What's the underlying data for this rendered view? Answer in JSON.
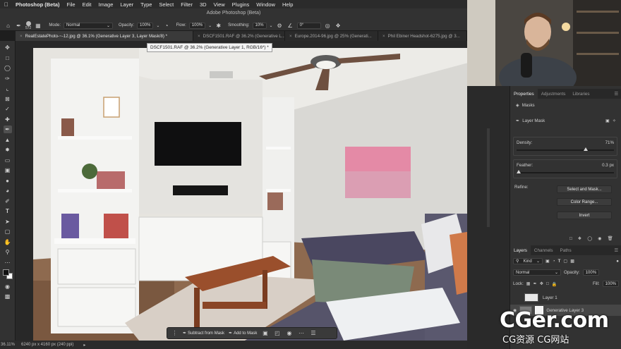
{
  "menubar": {
    "app_name": "Photoshop (Beta)",
    "items": [
      "File",
      "Edit",
      "Image",
      "Layer",
      "Type",
      "Select",
      "Filter",
      "3D",
      "View",
      "Plugins",
      "Window",
      "Help"
    ]
  },
  "window_title": "Adobe Photoshop (Beta)",
  "options": {
    "brush_size": "572",
    "mode_label": "Mode:",
    "mode_value": "Normal",
    "opacity_label": "Opacity:",
    "opacity_value": "100%",
    "flow_label": "Flow:",
    "flow_value": "100%",
    "smoothing_label": "Smoothing:",
    "smoothing_value": "10%",
    "angle_value": "0°"
  },
  "tabs": [
    {
      "label": "RealEstatePhoto-~-12.jpg @ 36.1% (Generative Layer 3, Layer Mask/8) *",
      "active": true
    },
    {
      "label": "DSCF1501.RAF @ 36.2% (Generative L...",
      "active": false
    },
    {
      "label": "Europe.2014-96.jpg @ 25% (Generati...",
      "active": false
    },
    {
      "label": "Phil Ebiner Headshot-6275.jpg @ 3...",
      "active": false
    }
  ],
  "tooltip": "DSCF1501.RAF @ 36.2% (Generative Layer 1, RGB/16*) *",
  "taskbar": {
    "subtract_label": "Subtract from Mask",
    "add_label": "Add to Mask"
  },
  "status": {
    "zoom": "36.11%",
    "doc_size": "6240 px x 4160 px (240 ppi)"
  },
  "properties": {
    "tabs": [
      "Properties",
      "Adjustments",
      "Libraries"
    ],
    "masks_label": "Masks",
    "layer_mask_label": "Layer Mask",
    "density_label": "Density:",
    "density_value": "71%",
    "density_level": 0.71,
    "feather_label": "Feather:",
    "feather_value": "0.3 px",
    "feather_level": 0.02,
    "refine_label": "Refine:",
    "select_mask_button": "Select and Mask...",
    "color_range_button": "Color Range...",
    "invert_button": "Invert"
  },
  "layers": {
    "tabs": [
      "Layers",
      "Channels",
      "Paths"
    ],
    "kind_label": "Kind",
    "blend_mode": "Normal",
    "opacity_label": "Opacity:",
    "opacity_value": "100%",
    "lock_label": "Lock:",
    "fill_label": "Fill:",
    "fill_value": "100%",
    "rows": [
      "Layer 1",
      "Generative Layer 3"
    ]
  },
  "watermark": {
    "big": "CGer.com",
    "small": "CG资源 CG网站"
  }
}
